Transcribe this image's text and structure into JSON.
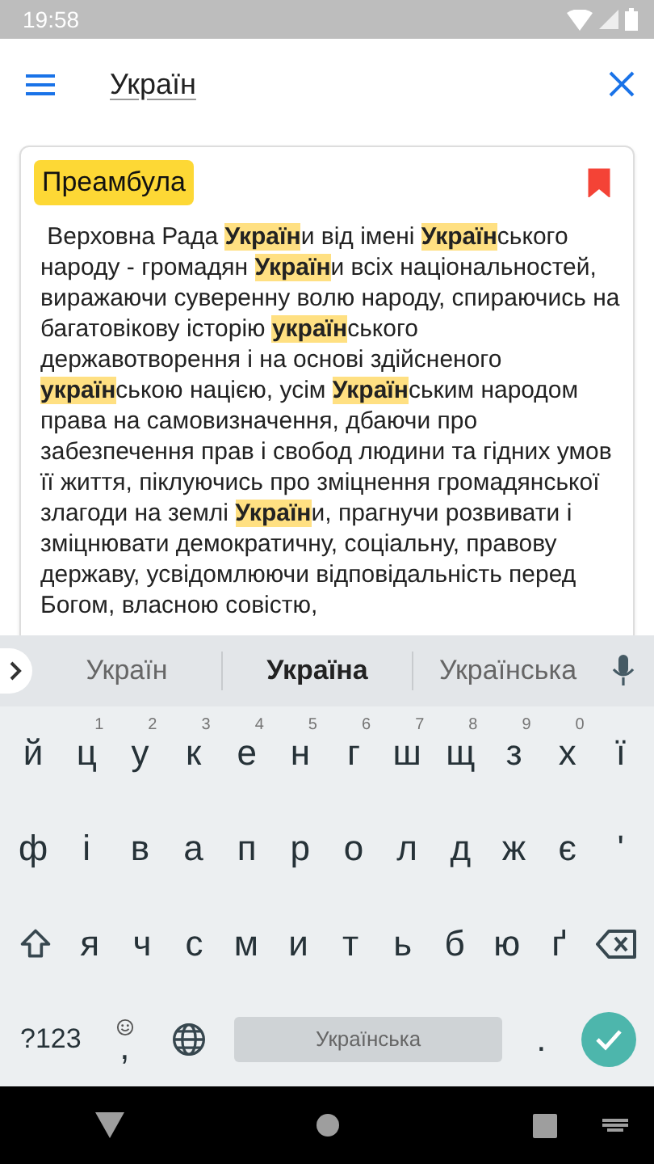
{
  "status_bar": {
    "time": "19:58"
  },
  "search": {
    "value": "Україн"
  },
  "card": {
    "title": "Преамбула",
    "bookmarked": true,
    "text": " Верховна Рада **Україн**и від імені **Україн**ського народу - громадян **Україн**и всіх національностей, виражаючи суверенну волю народу, спираючись на багатовікову історію **україн**ського державотворення і на основі здійсненого **україн**ською нацією, усім **Україн**ським народом права на самовизначення, дбаючи про забезпечення прав і свобод людини та гідних умов її життя, піклуючись про зміцнення громадянської злагоди на землі **Україн**и, прагнучи розвивати і зміцнювати демократичну, соціальну, правову державу, усвідомлюючи відповідальність перед Богом, власною совістю,"
  },
  "keyboard": {
    "suggestions": [
      {
        "label": "Україн",
        "selected": false
      },
      {
        "label": "Україна",
        "selected": true
      },
      {
        "label": "Українська",
        "selected": false
      }
    ],
    "letter_rows": [
      [
        {
          "kind": "letter",
          "label": "й"
        },
        {
          "kind": "letter",
          "label": "ц",
          "hint": "1"
        },
        {
          "kind": "letter",
          "label": "у",
          "hint": "2"
        },
        {
          "kind": "letter",
          "label": "к",
          "hint": "3"
        },
        {
          "kind": "letter",
          "label": "е",
          "hint": "4"
        },
        {
          "kind": "letter",
          "label": "н",
          "hint": "5"
        },
        {
          "kind": "letter",
          "label": "г",
          "hint": "6"
        },
        {
          "kind": "letter",
          "label": "ш",
          "hint": "7"
        },
        {
          "kind": "letter",
          "label": "щ",
          "hint": "8"
        },
        {
          "kind": "letter",
          "label": "з",
          "hint": "9"
        },
        {
          "kind": "letter",
          "label": "х",
          "hint": "0"
        },
        {
          "kind": "letter",
          "label": "ї"
        }
      ],
      [
        {
          "kind": "letter",
          "label": "ф"
        },
        {
          "kind": "letter",
          "label": "і"
        },
        {
          "kind": "letter",
          "label": "в"
        },
        {
          "kind": "letter",
          "label": "а"
        },
        {
          "kind": "letter",
          "label": "п"
        },
        {
          "kind": "letter",
          "label": "р"
        },
        {
          "kind": "letter",
          "label": "о"
        },
        {
          "kind": "letter",
          "label": "л"
        },
        {
          "kind": "letter",
          "label": "д"
        },
        {
          "kind": "letter",
          "label": "ж"
        },
        {
          "kind": "letter",
          "label": "є"
        },
        {
          "kind": "letter",
          "label": "'"
        }
      ],
      [
        {
          "kind": "shift"
        },
        {
          "kind": "letter",
          "label": "я"
        },
        {
          "kind": "letter",
          "label": "ч"
        },
        {
          "kind": "letter",
          "label": "с"
        },
        {
          "kind": "letter",
          "label": "м"
        },
        {
          "kind": "letter",
          "label": "и"
        },
        {
          "kind": "letter",
          "label": "т"
        },
        {
          "kind": "letter",
          "label": "ь"
        },
        {
          "kind": "letter",
          "label": "б"
        },
        {
          "kind": "letter",
          "label": "ю"
        },
        {
          "kind": "letter",
          "label": "ґ"
        },
        {
          "kind": "backspace"
        }
      ]
    ],
    "bottom_row": [
      {
        "kind": "symbols",
        "label": "?123"
      },
      {
        "kind": "comma",
        "label": ","
      },
      {
        "kind": "globe"
      },
      {
        "kind": "space",
        "label": "Українська"
      },
      {
        "kind": "letter",
        "label": "."
      },
      {
        "kind": "enter"
      }
    ]
  }
}
